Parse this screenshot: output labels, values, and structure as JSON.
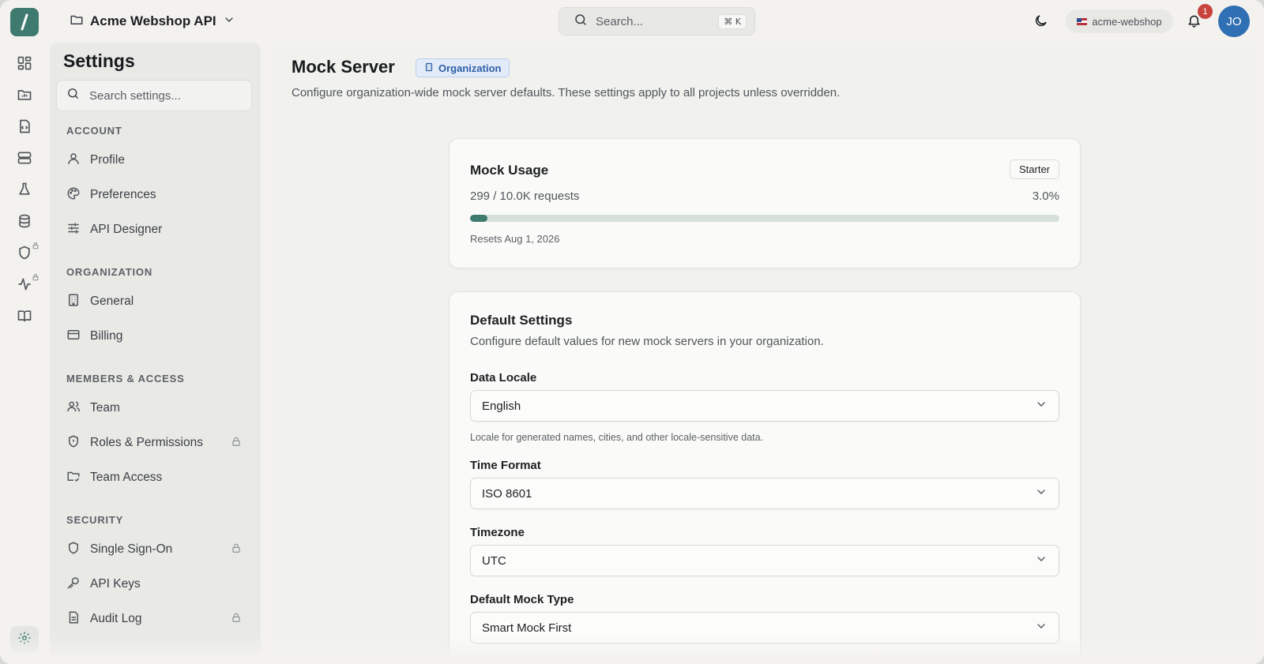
{
  "topbar": {
    "project_name": "Acme Webshop API",
    "search_placeholder": "Search...",
    "search_shortcut": "⌘ K",
    "workspace": "acme-webshop",
    "notification_count": "1",
    "avatar_initials": "JO"
  },
  "rail": {
    "icons": [
      "dashboard-icon",
      "folder-chart-icon",
      "code-file-icon",
      "server-icon",
      "flask-icon",
      "database-icon",
      "shield-icon",
      "activity-icon",
      "book-icon",
      "gear-icon"
    ],
    "locked": [
      "shield-icon",
      "activity-icon"
    ]
  },
  "sidebar": {
    "title": "Settings",
    "search_placeholder": "Search settings...",
    "sections": [
      {
        "title": "ACCOUNT",
        "items": [
          {
            "label": "Profile",
            "icon": "user-icon",
            "locked": false
          },
          {
            "label": "Preferences",
            "icon": "palette-icon",
            "locked": false
          },
          {
            "label": "API Designer",
            "icon": "sliders-icon",
            "locked": false
          }
        ]
      },
      {
        "title": "ORGANIZATION",
        "items": [
          {
            "label": "General",
            "icon": "building-icon",
            "locked": false
          },
          {
            "label": "Billing",
            "icon": "credit-card-icon",
            "locked": false
          }
        ]
      },
      {
        "title": "MEMBERS & ACCESS",
        "items": [
          {
            "label": "Team",
            "icon": "users-icon",
            "locked": false
          },
          {
            "label": "Roles & Permissions",
            "icon": "shield-icon",
            "locked": true
          },
          {
            "label": "Team Access",
            "icon": "folder-access-icon",
            "locked": false
          }
        ]
      },
      {
        "title": "SECURITY",
        "items": [
          {
            "label": "Single Sign-On",
            "icon": "shield-icon",
            "locked": true
          },
          {
            "label": "API Keys",
            "icon": "key-icon",
            "locked": false
          },
          {
            "label": "Audit Log",
            "icon": "file-text-icon",
            "locked": true
          }
        ]
      }
    ]
  },
  "main": {
    "title": "Mock Server",
    "scope_badge": "Organization",
    "description": "Configure organization-wide mock server defaults. These settings apply to all projects unless overridden.",
    "usage": {
      "title": "Mock Usage",
      "plan": "Starter",
      "count_text": "299 / 10.0K requests",
      "percent_text": "3.0%",
      "percent_value": 3.0,
      "reset_text": "Resets Aug 1, 2026"
    },
    "defaults": {
      "title": "Default Settings",
      "description": "Configure default values for new mock servers in your organization.",
      "fields": {
        "data_locale": {
          "label": "Data Locale",
          "value": "English",
          "hint": "Locale for generated names, cities, and other locale-sensitive data."
        },
        "time_format": {
          "label": "Time Format",
          "value": "ISO 8601"
        },
        "timezone": {
          "label": "Timezone",
          "value": "UTC"
        },
        "mock_type": {
          "label": "Default Mock Type",
          "value": "Smart Mock First"
        }
      }
    }
  },
  "colors": {
    "accent": "#3f7a6f",
    "badge_red": "#c7433c",
    "avatar_blue": "#2f6fb3",
    "org_badge": "#2d5fa8"
  }
}
